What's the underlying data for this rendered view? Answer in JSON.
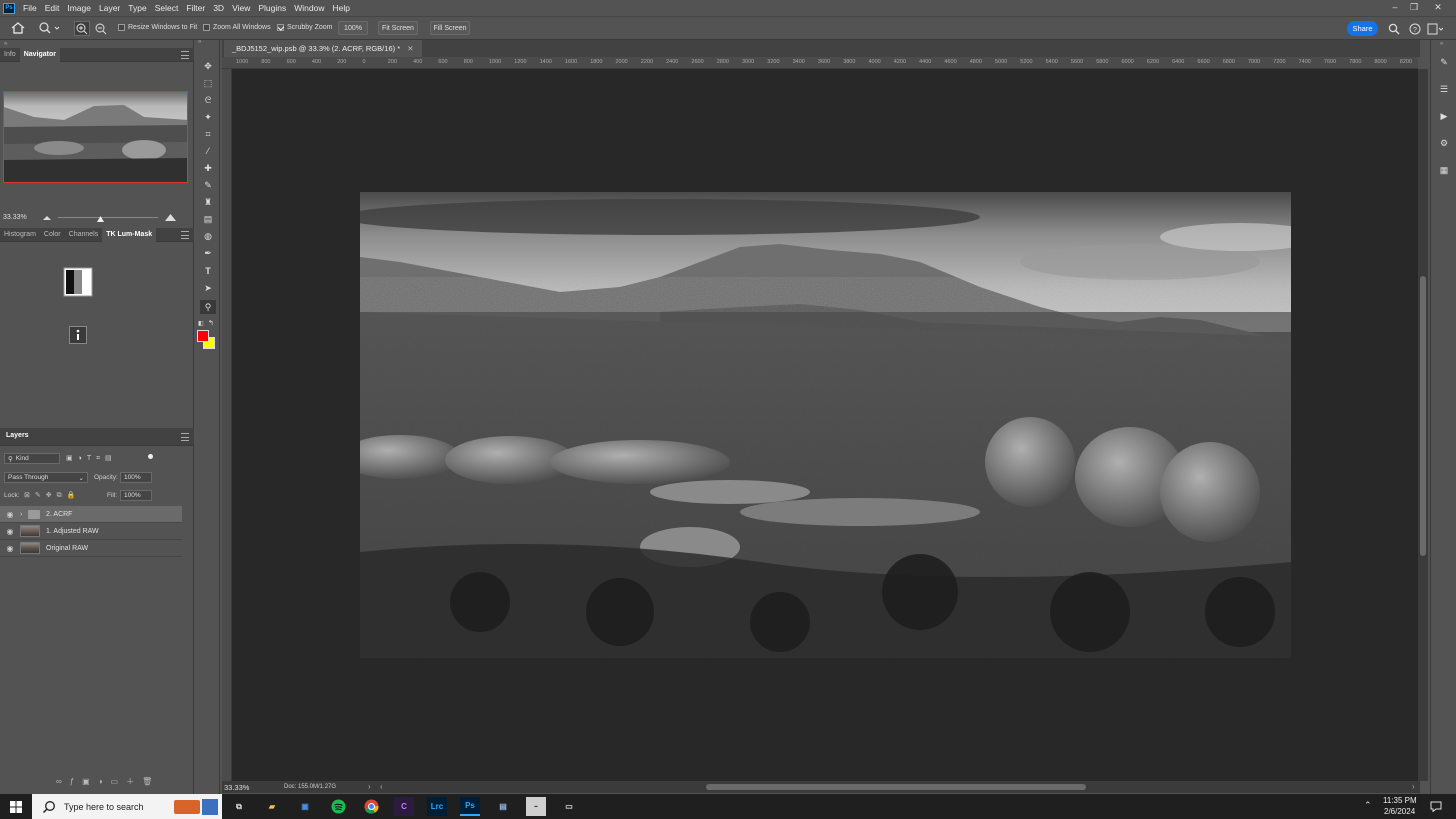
{
  "app": {
    "logo": "Ps",
    "accent": "#31a8ff"
  },
  "menu": [
    "File",
    "Edit",
    "Image",
    "Layer",
    "Type",
    "Select",
    "Filter",
    "3D",
    "View",
    "Plugins",
    "Window",
    "Help"
  ],
  "window_controls": {
    "minimize": "–",
    "restore": "❐",
    "close": "✕"
  },
  "options": {
    "resize_windows": "Resize Windows to Fit",
    "zoom_all_windows": "Zoom All Windows",
    "scrubby_zoom": "Scrubby Zoom",
    "zoom_value": "100%",
    "fit_screen": "Fit Screen",
    "fill_screen": "Fill Screen",
    "share": "Share",
    "share_color": "#1473e6"
  },
  "navigator": {
    "tabs": [
      "Info",
      "Navigator"
    ],
    "zoom": "33.33%"
  },
  "panel2": {
    "tabs": [
      "Histogram",
      "Color",
      "Channels",
      "TK Lum-Mask"
    ]
  },
  "layers": {
    "title": "Layers",
    "kind": "Kind",
    "blend": "Pass Through",
    "opacity_label": "Opacity:",
    "opacity": "100%",
    "lock_label": "Lock:",
    "fill_label": "Fill:",
    "fill": "100%",
    "items": [
      {
        "name": "2. ACRF",
        "type": "group"
      },
      {
        "name": "1. Adjusted RAW",
        "type": "pixel"
      },
      {
        "name": "Original RAW",
        "type": "pixel"
      }
    ]
  },
  "document": {
    "tab_title": "_BDJ5152_wip.psb @ 33.3% (2. ACRF, RGB/16) *",
    "tab_close": "✕",
    "zoom": "33.33%",
    "doc_size": "Doc: 155.0M/1.27G",
    "ruler_ticks": [
      "1000",
      "800",
      "600",
      "400",
      "200",
      "0",
      "200",
      "400",
      "600",
      "800",
      "1000",
      "1200",
      "1400",
      "1600",
      "1800",
      "2000",
      "2200",
      "2400",
      "2600",
      "2800",
      "3000",
      "3200",
      "3400",
      "3600",
      "3800",
      "4000",
      "4200",
      "4400",
      "4600",
      "4800",
      "5000",
      "5200",
      "5400",
      "5600",
      "5800",
      "6000",
      "6200",
      "6400",
      "6600",
      "6800",
      "7000",
      "7200",
      "7400",
      "7600",
      "7800",
      "8000",
      "8200"
    ]
  },
  "taskbar": {
    "search_placeholder": "Type here to search",
    "time": "11:35 PM",
    "date": "2/6/2024",
    "apps": [
      {
        "name": "Lrc",
        "color": "#31a8ff"
      },
      {
        "name": "Ps",
        "color": "#31a8ff"
      }
    ]
  },
  "colors": {
    "foreground": "#ff0000",
    "background": "#ffff00"
  }
}
